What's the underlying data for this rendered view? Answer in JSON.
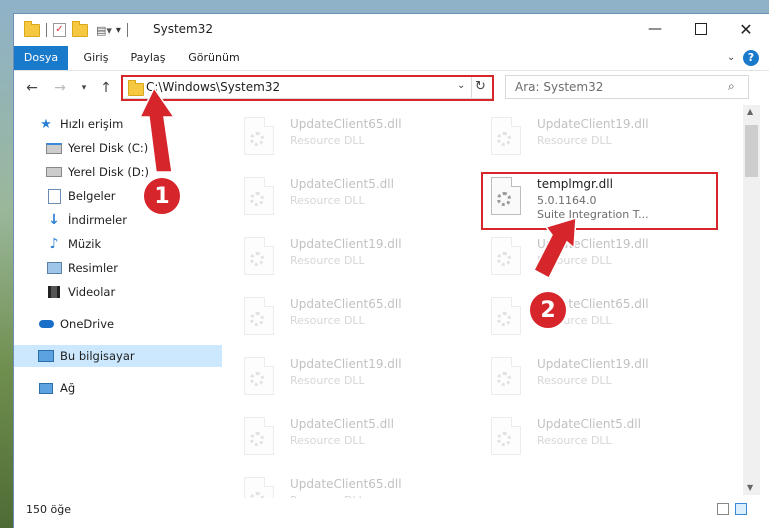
{
  "window": {
    "title": "System32"
  },
  "ribbon": {
    "tabs": [
      "Dosya",
      "Giriş",
      "Paylaş",
      "Görünüm"
    ],
    "help": "?"
  },
  "nav": {
    "address": "C:\\Windows\\System32",
    "search_placeholder": "Ara: System32"
  },
  "sidebar": {
    "items": [
      {
        "label": "Hızlı erişim",
        "icon": "star-icon"
      },
      {
        "label": "Yerel Disk (C:)",
        "icon": "drive-icon"
      },
      {
        "label": "Yerel Disk (D:)",
        "icon": "drive-icon"
      },
      {
        "label": "Belgeler",
        "icon": "documents-icon"
      },
      {
        "label": "İndirmeler",
        "icon": "download-icon"
      },
      {
        "label": "Müzik",
        "icon": "music-icon"
      },
      {
        "label": "Resimler",
        "icon": "pictures-icon"
      },
      {
        "label": "Videolar",
        "icon": "videos-icon"
      },
      {
        "label": "OneDrive",
        "icon": "cloud-icon"
      },
      {
        "label": "Bu bilgisayar",
        "icon": "computer-icon"
      },
      {
        "label": "Ağ",
        "icon": "network-icon"
      }
    ]
  },
  "files": {
    "left": [
      {
        "name": "UpdateClient65.dll",
        "type": "Resource DLL"
      },
      {
        "name": "UpdateClient5.dll",
        "type": "Resource DLL"
      },
      {
        "name": "UpdateClient19.dll",
        "type": "Resource DLL"
      },
      {
        "name": "UpdateClient65.dll",
        "type": "Resource DLL"
      },
      {
        "name": "UpdateClient19.dll",
        "type": "Resource DLL"
      },
      {
        "name": "UpdateClient5.dll",
        "type": "Resource DLL"
      },
      {
        "name": "UpdateClient65.dll",
        "type": "Resource DLL"
      }
    ],
    "right": [
      {
        "name": "UpdateClient19.dll",
        "type": "Resource DLL"
      },
      {
        "name": "templmgr.dll",
        "version": "5.0.1164.0",
        "desc": "Suite Integration T..."
      },
      {
        "name": "UpdateClient19.dll",
        "type": "Resource DLL"
      },
      {
        "name": "UpdateClient65.dll",
        "type": "Resource DLL"
      },
      {
        "name": "UpdateClient19.dll",
        "type": "Resource DLL"
      },
      {
        "name": "UpdateClient5.dll",
        "type": "Resource DLL"
      }
    ]
  },
  "status": {
    "count": "150 öğe"
  },
  "annotations": {
    "badge1": "1",
    "badge2": "2",
    "color": "#d7262b"
  }
}
